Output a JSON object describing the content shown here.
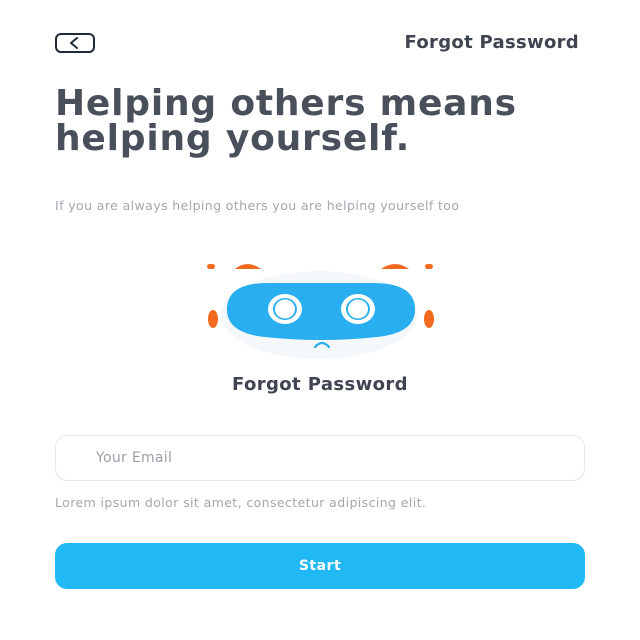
{
  "header": {
    "back_icon": "chevron-left-icon",
    "title": "Forgot Password"
  },
  "hero": {
    "headline": "Helping others means helping yourself.",
    "subtext": "If you are always helping others you are helping yourself too"
  },
  "illustration": {
    "name": "robot-face",
    "colors": {
      "face": "#29aef0",
      "accent": "#f26a1f",
      "eye_white": "#ffffff"
    }
  },
  "form": {
    "title": "Forgot Password",
    "email_placeholder": "Your Email",
    "helper_text": "Lorem ipsum dolor sit amet, consectetur adipiscing elit.",
    "submit_label": "Start"
  },
  "theme": {
    "primary": "#22b8f5",
    "heading": "#4a4f5c",
    "muted": "#a3a7ae"
  }
}
